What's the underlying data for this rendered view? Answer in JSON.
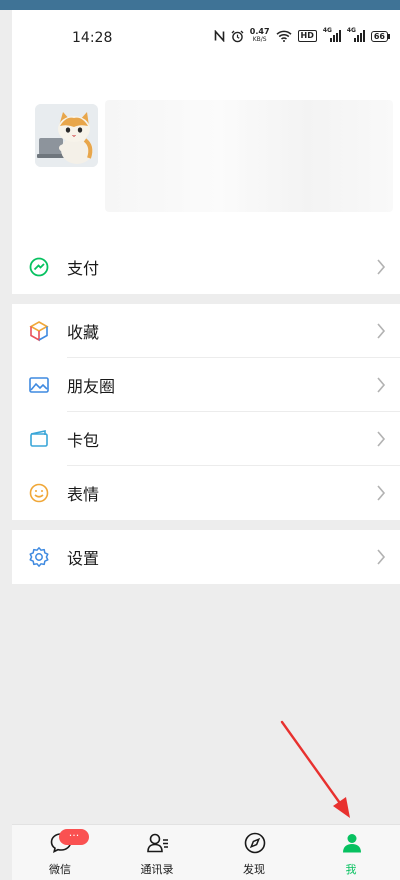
{
  "status_bar": {
    "time": "14:28",
    "net_speed": "0.47",
    "net_unit": "KB/S",
    "hd": "HD",
    "signal_gen": "4G",
    "battery": "66"
  },
  "menu": {
    "pay": "支付",
    "favorites": "收藏",
    "moments": "朋友圈",
    "cards": "卡包",
    "stickers": "表情",
    "settings": "设置"
  },
  "tabbar": {
    "chats": "微信",
    "chats_badge": "···",
    "contacts": "通讯录",
    "discover": "发现",
    "me": "我"
  },
  "colors": {
    "accent": "#07c160",
    "badge": "#fa5151",
    "arrow": "#e8312f"
  }
}
